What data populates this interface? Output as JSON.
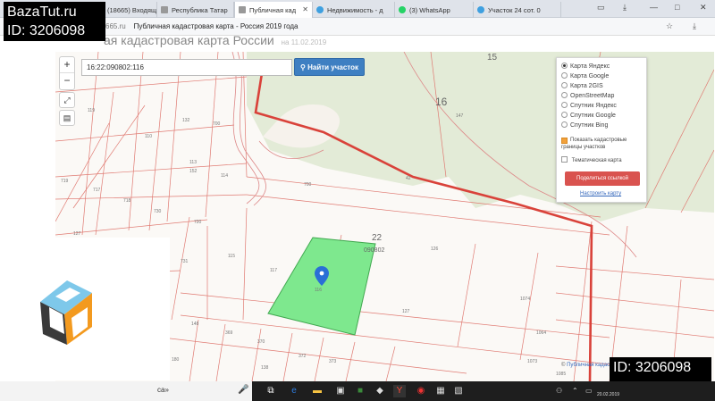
{
  "watermark": {
    "site": "BazaTut.ru",
    "id_label": "ID: 3206098"
  },
  "browser": {
    "tabs": [
      {
        "label": "(18665) Входящи",
        "icon_color": "#b23c3c",
        "closable": false
      },
      {
        "label": "Республика Татар",
        "icon_color": "#888888",
        "closable": false
      },
      {
        "label": "Публичная кад",
        "icon_color": "#888888",
        "closable": true,
        "active": true
      },
      {
        "label": "Недвижимость - д",
        "icon_color": "#3fa0e0",
        "closable": false
      },
      {
        "label": "(3) WhatsApp",
        "icon_color": "#25d366",
        "closable": false
      },
      {
        "label": "Участок 24 сот. 0",
        "icon_color": "#3fa0e0",
        "closable": false
      }
    ],
    "url_fragment": "665.ru",
    "page_title": "Публичная кадастровая карта - Россия 2019 года",
    "header_partial": "ая кадастровая карта России",
    "header_date": "на 11.02.2019"
  },
  "map": {
    "search_value": "16:22:090802:116",
    "search_button": "Найти участок",
    "zoom_in": "+",
    "zoom_out": "−",
    "region_labels": [
      "15",
      "16",
      "22",
      "090802"
    ],
    "parcel_numbers": [
      "119",
      "132",
      "700",
      "110",
      "113",
      "152",
      "114",
      "719",
      "717",
      "718",
      "730",
      "127",
      "720",
      "731",
      "115",
      "117",
      "116",
      "147",
      "42",
      "700",
      "126",
      "127",
      "1074",
      "1064",
      "148",
      "369",
      "370",
      "372",
      "373",
      "1073",
      "1085",
      "180",
      "138"
    ],
    "layers": {
      "base_maps": [
        {
          "label": "Карта Яндекс",
          "selected": true
        },
        {
          "label": "Карта Google",
          "selected": false
        },
        {
          "label": "Карта 2GIS",
          "selected": false
        },
        {
          "label": "OpenStreetMap",
          "selected": false
        },
        {
          "label": "Спутник Яндекс",
          "selected": false
        },
        {
          "label": "Спутник Google",
          "selected": false
        },
        {
          "label": "Спутник Bing",
          "selected": false
        }
      ],
      "show_borders_label": "Показать кадастровые границы участков",
      "show_borders_checked": true,
      "thematic_label": "Тематическая карта",
      "thematic_checked": false,
      "share_button": "Поделиться ссылкой",
      "configure_link": "Настроить карту"
    },
    "credit_prefix": "©",
    "credit_link": "Публичная кадастр"
  },
  "taskbar": {
    "search_text": "са»",
    "clock_date": "20.02.2019"
  },
  "colors": {
    "selected_parcel": "#7ee88e",
    "district_border": "#d9423a",
    "parcel_lines": "#e07a72",
    "forest": "#e3ebd7",
    "marker": "#2a6fd6"
  }
}
